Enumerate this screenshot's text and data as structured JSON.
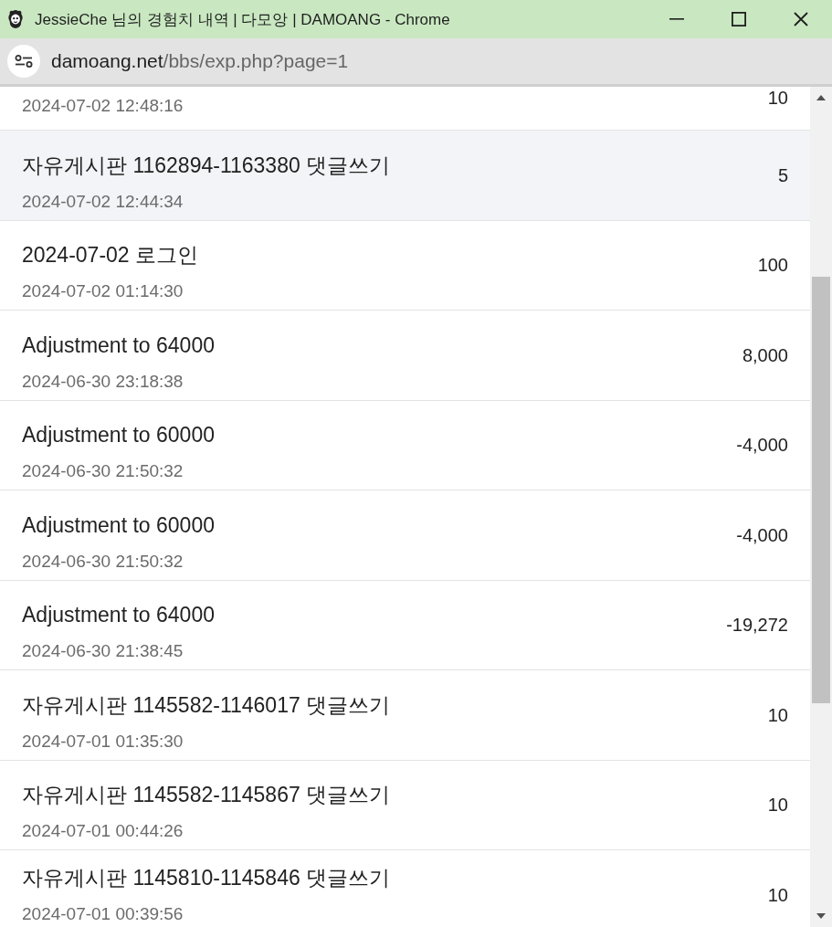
{
  "window": {
    "title": "JessieChe 님의 경험치 내역 | 다모앙 | DAMOANG - Chrome"
  },
  "address_bar": {
    "host": "damoang.net",
    "path": "/bbs/exp.php?page=1"
  },
  "rows": [
    {
      "time": "2024-07-02 12:48:16",
      "amount": "10",
      "highlighted": false
    },
    {
      "title": "자유게시판 1162894-1163380 댓글쓰기",
      "time": "2024-07-02 12:44:34",
      "amount": "5",
      "highlighted": true
    },
    {
      "title": "2024-07-02 로그인",
      "time": "2024-07-02 01:14:30",
      "amount": "100",
      "highlighted": false
    },
    {
      "title": "Adjustment to 64000",
      "time": "2024-06-30 23:18:38",
      "amount": "8,000",
      "highlighted": false
    },
    {
      "title": "Adjustment to 60000",
      "time": "2024-06-30 21:50:32",
      "amount": "-4,000",
      "highlighted": false
    },
    {
      "title": "Adjustment to 60000",
      "time": "2024-06-30 21:50:32",
      "amount": "-4,000",
      "highlighted": false
    },
    {
      "title": "Adjustment to 64000",
      "time": "2024-06-30 21:38:45",
      "amount": "-19,272",
      "highlighted": false
    },
    {
      "title": "자유게시판 1145582-1146017 댓글쓰기",
      "time": "2024-07-01 01:35:30",
      "amount": "10",
      "highlighted": false
    },
    {
      "title": "자유게시판 1145582-1145867 댓글쓰기",
      "time": "2024-07-01 00:44:26",
      "amount": "10",
      "highlighted": false
    },
    {
      "title": "자유게시판 1145810-1145846 댓글쓰기",
      "time": "2024-07-01 00:39:56",
      "amount": "10",
      "highlighted": false
    }
  ]
}
